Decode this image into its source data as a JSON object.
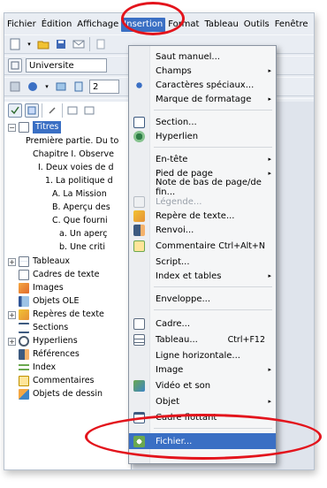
{
  "menubar": {
    "items": [
      "Fichier",
      "Édition",
      "Affichage",
      "Insertion",
      "Format",
      "Tableau",
      "Outils",
      "Fenêtre"
    ]
  },
  "toolbar2": {
    "style_value": "Universite"
  },
  "toolbar3": {
    "page_value": "2"
  },
  "navigator": {
    "titles_label": "Titres",
    "outline": [
      "Première partie. Du to",
      "Chapitre I. Observe",
      "I. Deux voies de d",
      "1. La politique d",
      "A. La Mission",
      "B. Aperçu des",
      "C. Que fourni",
      "a. Un aperç",
      "b. Une criti"
    ],
    "categories": [
      "Tableaux",
      "Cadres de texte",
      "Images",
      "Objets OLE",
      "Repères de texte",
      "Sections",
      "Hyperliens",
      "Références",
      "Index",
      "Commentaires",
      "Objets de dessin"
    ]
  },
  "insert_menu": {
    "items": {
      "saut_manuel": "Saut manuel...",
      "champs": "Champs",
      "caracteres_speciaux": "Caractères spéciaux...",
      "marque_formatage": "Marque de formatage",
      "section": "Section...",
      "hyperlien": "Hyperlien",
      "entete": "En-tête",
      "pied_de_page": "Pied de page",
      "note_bas_page": "Note de bas de page/de fin...",
      "legende": "Légende...",
      "repere_texte": "Repère de texte...",
      "renvoi": "Renvoi...",
      "commentaire": "Commentaire",
      "script": "Script...",
      "index_tables": "Index et tables",
      "enveloppe": "Enveloppe...",
      "cadre": "Cadre...",
      "tableau": "Tableau...",
      "ligne_horizontale": "Ligne horizontale...",
      "image": "Image",
      "video_son": "Vidéo et son",
      "objet": "Objet",
      "cadre_flottant": "Cadre flottant",
      "fichier": "Fichier..."
    },
    "shortcuts": {
      "commentaire": "Ctrl+Alt+N",
      "tableau": "Ctrl+F12"
    }
  },
  "colors": {
    "highlight": "#3a6fc4",
    "annotation": "#e3141c"
  }
}
